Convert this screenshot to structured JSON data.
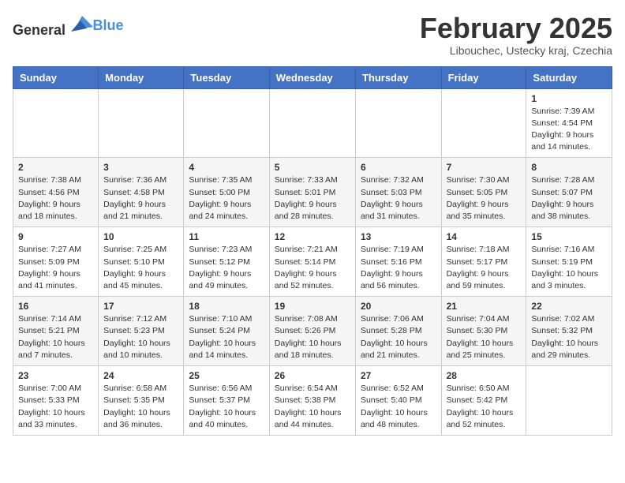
{
  "header": {
    "logo_general": "General",
    "logo_blue": "Blue",
    "month_year": "February 2025",
    "location": "Libouchec, Ustecky kraj, Czechia"
  },
  "days_of_week": [
    "Sunday",
    "Monday",
    "Tuesday",
    "Wednesday",
    "Thursday",
    "Friday",
    "Saturday"
  ],
  "weeks": [
    [
      {
        "day": "",
        "info": ""
      },
      {
        "day": "",
        "info": ""
      },
      {
        "day": "",
        "info": ""
      },
      {
        "day": "",
        "info": ""
      },
      {
        "day": "",
        "info": ""
      },
      {
        "day": "",
        "info": ""
      },
      {
        "day": "1",
        "info": "Sunrise: 7:39 AM\nSunset: 4:54 PM\nDaylight: 9 hours\nand 14 minutes."
      }
    ],
    [
      {
        "day": "2",
        "info": "Sunrise: 7:38 AM\nSunset: 4:56 PM\nDaylight: 9 hours\nand 18 minutes."
      },
      {
        "day": "3",
        "info": "Sunrise: 7:36 AM\nSunset: 4:58 PM\nDaylight: 9 hours\nand 21 minutes."
      },
      {
        "day": "4",
        "info": "Sunrise: 7:35 AM\nSunset: 5:00 PM\nDaylight: 9 hours\nand 24 minutes."
      },
      {
        "day": "5",
        "info": "Sunrise: 7:33 AM\nSunset: 5:01 PM\nDaylight: 9 hours\nand 28 minutes."
      },
      {
        "day": "6",
        "info": "Sunrise: 7:32 AM\nSunset: 5:03 PM\nDaylight: 9 hours\nand 31 minutes."
      },
      {
        "day": "7",
        "info": "Sunrise: 7:30 AM\nSunset: 5:05 PM\nDaylight: 9 hours\nand 35 minutes."
      },
      {
        "day": "8",
        "info": "Sunrise: 7:28 AM\nSunset: 5:07 PM\nDaylight: 9 hours\nand 38 minutes."
      }
    ],
    [
      {
        "day": "9",
        "info": "Sunrise: 7:27 AM\nSunset: 5:09 PM\nDaylight: 9 hours\nand 41 minutes."
      },
      {
        "day": "10",
        "info": "Sunrise: 7:25 AM\nSunset: 5:10 PM\nDaylight: 9 hours\nand 45 minutes."
      },
      {
        "day": "11",
        "info": "Sunrise: 7:23 AM\nSunset: 5:12 PM\nDaylight: 9 hours\nand 49 minutes."
      },
      {
        "day": "12",
        "info": "Sunrise: 7:21 AM\nSunset: 5:14 PM\nDaylight: 9 hours\nand 52 minutes."
      },
      {
        "day": "13",
        "info": "Sunrise: 7:19 AM\nSunset: 5:16 PM\nDaylight: 9 hours\nand 56 minutes."
      },
      {
        "day": "14",
        "info": "Sunrise: 7:18 AM\nSunset: 5:17 PM\nDaylight: 9 hours\nand 59 minutes."
      },
      {
        "day": "15",
        "info": "Sunrise: 7:16 AM\nSunset: 5:19 PM\nDaylight: 10 hours\nand 3 minutes."
      }
    ],
    [
      {
        "day": "16",
        "info": "Sunrise: 7:14 AM\nSunset: 5:21 PM\nDaylight: 10 hours\nand 7 minutes."
      },
      {
        "day": "17",
        "info": "Sunrise: 7:12 AM\nSunset: 5:23 PM\nDaylight: 10 hours\nand 10 minutes."
      },
      {
        "day": "18",
        "info": "Sunrise: 7:10 AM\nSunset: 5:24 PM\nDaylight: 10 hours\nand 14 minutes."
      },
      {
        "day": "19",
        "info": "Sunrise: 7:08 AM\nSunset: 5:26 PM\nDaylight: 10 hours\nand 18 minutes."
      },
      {
        "day": "20",
        "info": "Sunrise: 7:06 AM\nSunset: 5:28 PM\nDaylight: 10 hours\nand 21 minutes."
      },
      {
        "day": "21",
        "info": "Sunrise: 7:04 AM\nSunset: 5:30 PM\nDaylight: 10 hours\nand 25 minutes."
      },
      {
        "day": "22",
        "info": "Sunrise: 7:02 AM\nSunset: 5:32 PM\nDaylight: 10 hours\nand 29 minutes."
      }
    ],
    [
      {
        "day": "23",
        "info": "Sunrise: 7:00 AM\nSunset: 5:33 PM\nDaylight: 10 hours\nand 33 minutes."
      },
      {
        "day": "24",
        "info": "Sunrise: 6:58 AM\nSunset: 5:35 PM\nDaylight: 10 hours\nand 36 minutes."
      },
      {
        "day": "25",
        "info": "Sunrise: 6:56 AM\nSunset: 5:37 PM\nDaylight: 10 hours\nand 40 minutes."
      },
      {
        "day": "26",
        "info": "Sunrise: 6:54 AM\nSunset: 5:38 PM\nDaylight: 10 hours\nand 44 minutes."
      },
      {
        "day": "27",
        "info": "Sunrise: 6:52 AM\nSunset: 5:40 PM\nDaylight: 10 hours\nand 48 minutes."
      },
      {
        "day": "28",
        "info": "Sunrise: 6:50 AM\nSunset: 5:42 PM\nDaylight: 10 hours\nand 52 minutes."
      },
      {
        "day": "",
        "info": ""
      }
    ]
  ]
}
